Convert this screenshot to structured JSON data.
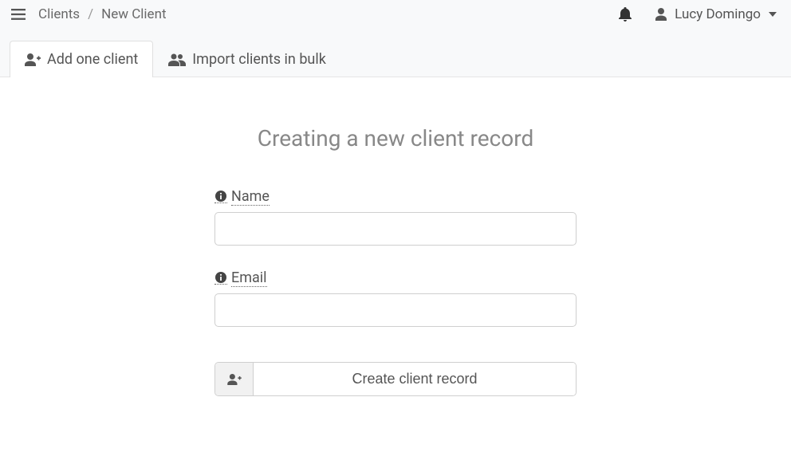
{
  "header": {
    "breadcrumb": {
      "parent": "Clients",
      "current": "New Client"
    },
    "user_name": "Lucy Domingo"
  },
  "tabs": {
    "add_one": "Add one client",
    "bulk": "Import clients in bulk"
  },
  "main": {
    "title": "Creating a new client record",
    "fields": {
      "name": {
        "label": "Name",
        "value": ""
      },
      "email": {
        "label": "Email",
        "value": ""
      }
    },
    "submit_label": "Create client record"
  }
}
